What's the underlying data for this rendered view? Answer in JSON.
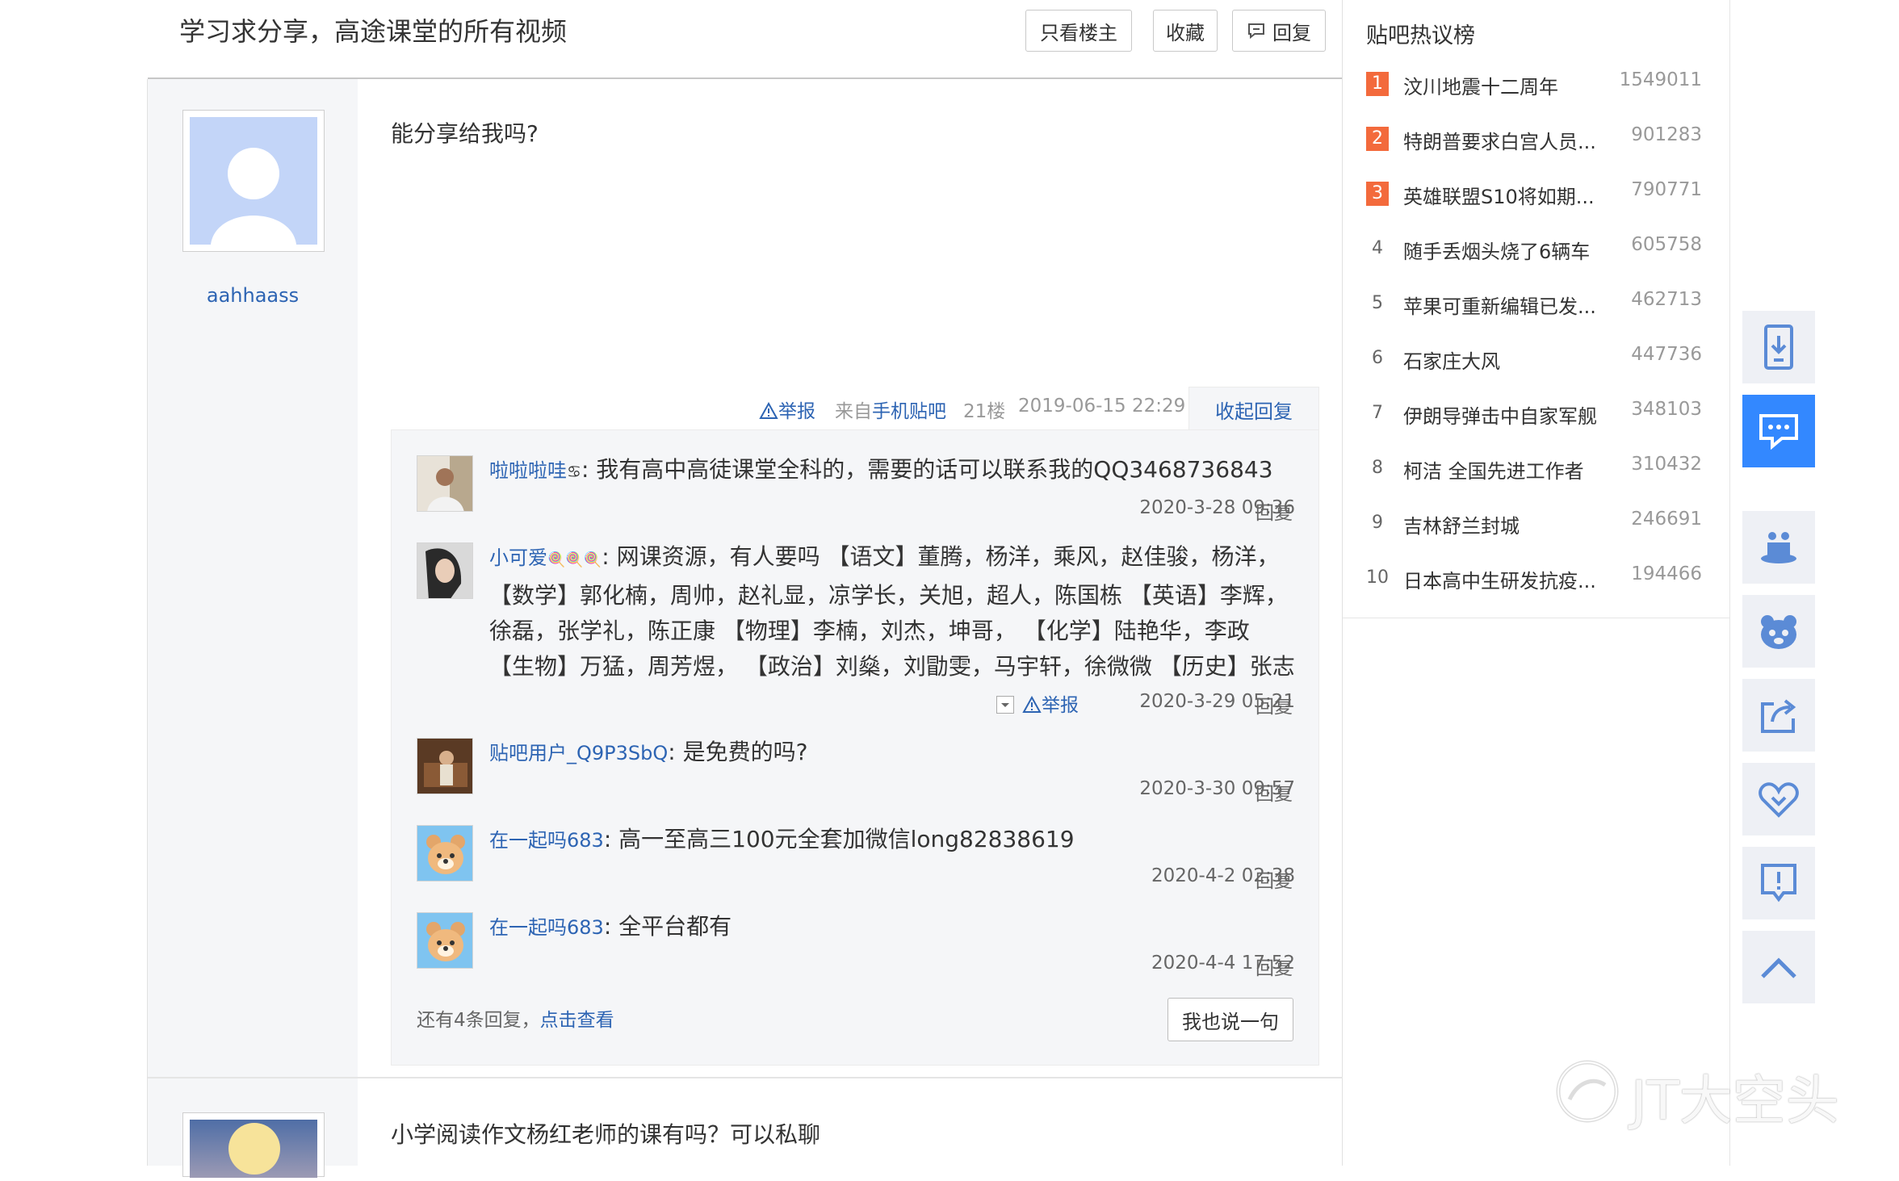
{
  "thread": {
    "title": "学习求分享，高途课堂的所有视频",
    "buttons": {
      "only_op": "只看楼主",
      "favorite": "收藏",
      "reply": "回复"
    }
  },
  "post1": {
    "username": "aahhaass",
    "content": "能分享给我吗?",
    "tail": {
      "report": "举报",
      "from_prefix": "来自",
      "from_app": "手机贴吧",
      "floor": "21楼",
      "datetime": "2019-06-15 22:29",
      "collapse": "收起回复"
    }
  },
  "replies": [
    {
      "name": "啦啦啦哇",
      "badge": "♋",
      "lines": [
        "我有高中高徒课堂全科的，需要的话可以联系我的QQ3468736843"
      ],
      "time": "2020-3-28 09:36",
      "reply": "回复"
    },
    {
      "name": "小可爱",
      "badge": "🍭🍭🍭",
      "lines": [
        "网课资源，有人要吗 【语文】董腾，杨洋，乘风，赵佳骏，杨洋，",
        "【数学】郭化楠，周帅，赵礼显，凉学长，关旭，超人，陈国栋 【英语】李辉，",
        "徐磊，张学礼，陈正康 【物理】李楠，刘杰，坤哥，  【化学】陆艳华，李政",
        "【生物】万猛，周芳煜，  【政治】刘燊，刘勖雯，马宇轩，徐微微 【历史】张志"
      ],
      "report": "举报",
      "time": "2020-3-29 05:21",
      "reply": "回复"
    },
    {
      "name": "贴吧用户_Q9P3SbQ",
      "lines": [
        "是免费的吗?"
      ],
      "time": "2020-3-30 09:57",
      "reply": "回复"
    },
    {
      "name": "在一起吗683",
      "lines": [
        "高一至高三100元全套加微信long82838619"
      ],
      "time": "2020-4-2 02:38",
      "reply": "回复"
    },
    {
      "name": "在一起吗683",
      "lines": [
        "全平台都有"
      ],
      "time": "2020-4-4 17:52",
      "reply": "回复"
    }
  ],
  "lzl_footer": {
    "more_prefix": "还有4条回复，",
    "more_link": "点击查看",
    "say_button": "我也说一句"
  },
  "post2": {
    "content": "小学阅读作文杨红老师的课有吗？可以私聊"
  },
  "hot": {
    "title": "贴吧热议榜",
    "items": [
      {
        "rank": "1",
        "title": "汶川地震十二周年",
        "count": "1549011"
      },
      {
        "rank": "2",
        "title": "特朗普要求白宫人员...",
        "count": "901283"
      },
      {
        "rank": "3",
        "title": "英雄联盟S10将如期...",
        "count": "790771"
      },
      {
        "rank": "4",
        "title": "随手丢烟头烧了6辆车",
        "count": "605758"
      },
      {
        "rank": "5",
        "title": "苹果可重新编辑已发...",
        "count": "462713"
      },
      {
        "rank": "6",
        "title": "石家庄大风",
        "count": "447736"
      },
      {
        "rank": "7",
        "title": "伊朗导弹击中自家军舰",
        "count": "348103"
      },
      {
        "rank": "8",
        "title": "柯洁 全国先进工作者",
        "count": "310432"
      },
      {
        "rank": "9",
        "title": "吉林舒兰封城",
        "count": "246691"
      },
      {
        "rank": "10",
        "title": "日本高中生研发抗疫...",
        "count": "194466"
      }
    ]
  },
  "watermark": "JT大空头",
  "colors": {
    "link": "#2d64b3",
    "rank_badge": "#f36a3c",
    "active_tool": "#3388ff"
  }
}
